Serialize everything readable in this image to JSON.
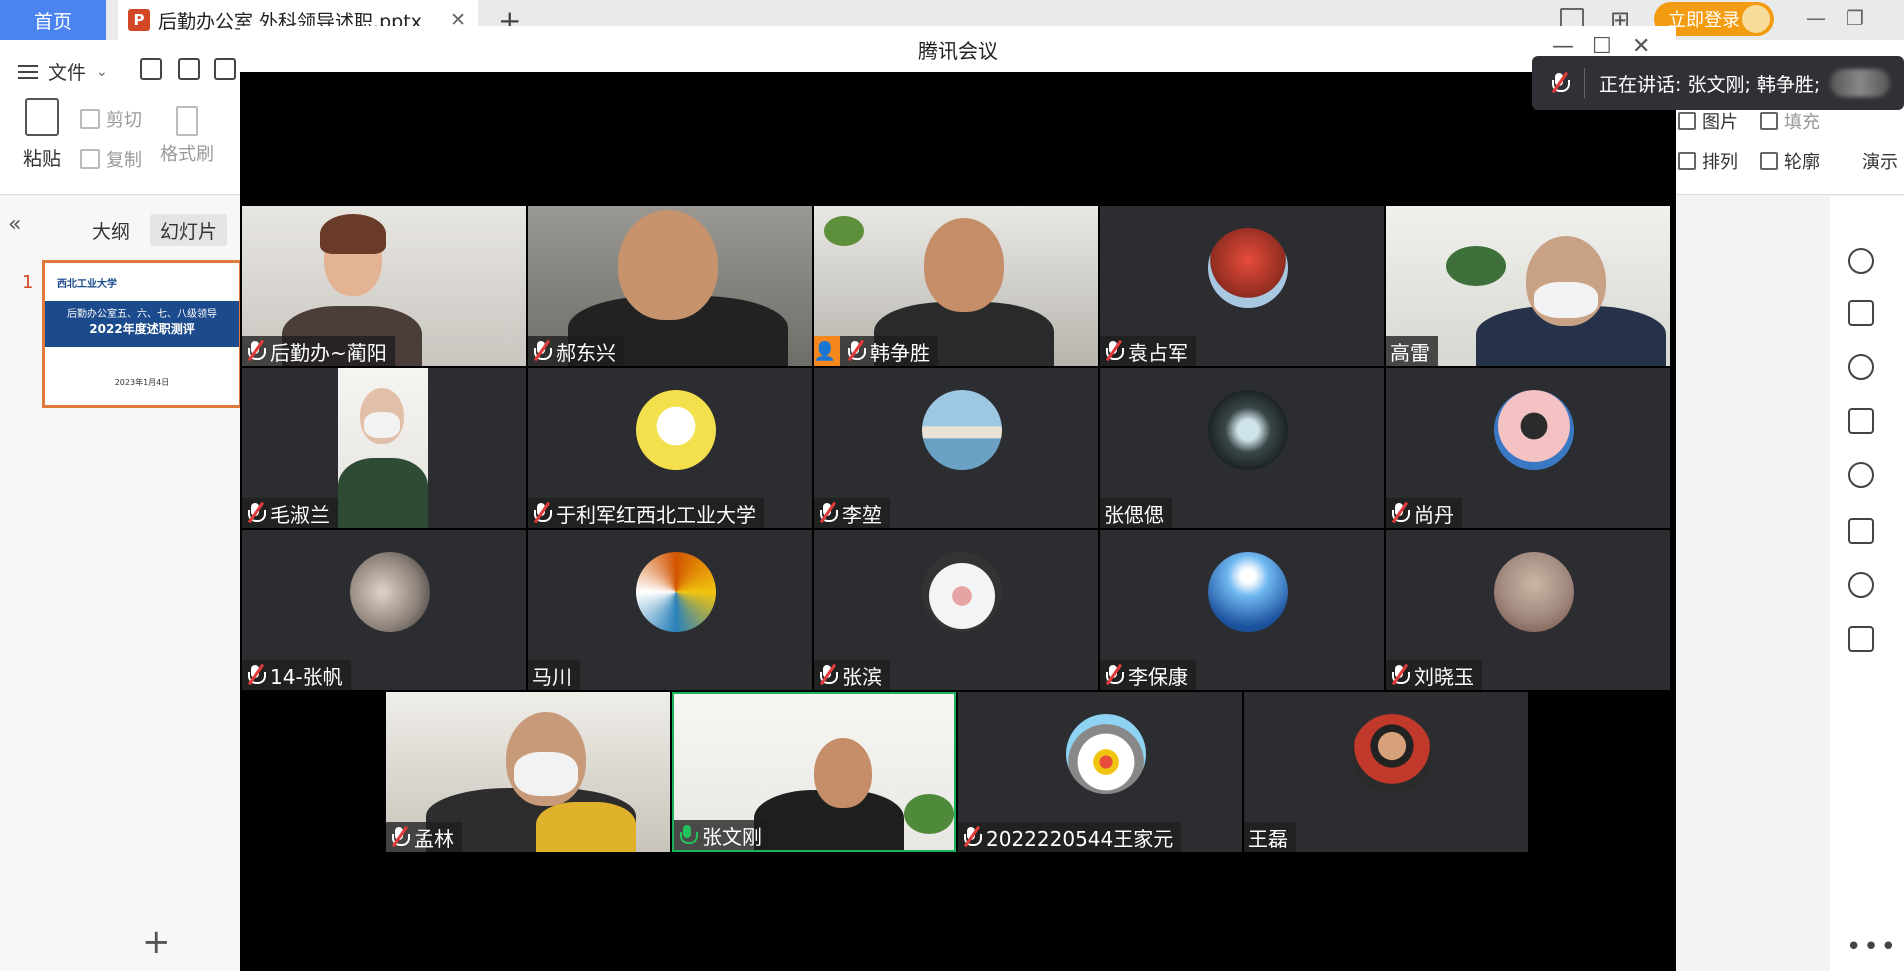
{
  "wps": {
    "home_tab": "首页",
    "doc_tab": "后勤办公室 外科领导述职.pptx",
    "doc_icon": "P",
    "login_label": "立即登录",
    "file_menu": "文件",
    "ribbon": {
      "paste": "粘贴",
      "cut": "剪切",
      "copy": "复制",
      "format_painter": "格式刷",
      "picture": "图片",
      "fill": "填充",
      "arrange": "排列",
      "outline": "轮廓",
      "present": "演示"
    },
    "pane_tabs": [
      "大纲",
      "幻灯片"
    ],
    "slide_number": "1",
    "thumb": {
      "logo": "西北工业大学",
      "line1": "后勤办公室五、六、七、八级领导",
      "line2": "2022年度述职测评",
      "date": "2023年1月4日"
    },
    "add_slide": "+"
  },
  "meeting": {
    "title": "腾讯会议",
    "speaking_label": "正在讲话: 张文刚; 韩争胜;",
    "participants": [
      {
        "name": "后勤办~蔺阳",
        "mic": "muted",
        "kind": "camera",
        "palette": "#c9c6c0"
      },
      {
        "name": "郝东兴",
        "mic": "muted",
        "kind": "camera",
        "palette": "#6e6d68"
      },
      {
        "name": "韩争胜",
        "mic": "muted",
        "kind": "camera",
        "host": true,
        "palette": "#b7b4ad"
      },
      {
        "name": "袁占军",
        "mic": "muted",
        "kind": "avatar",
        "color": "#c0392b"
      },
      {
        "name": "高雷",
        "mic": "none",
        "kind": "camera",
        "palette": "#d8d8d2"
      },
      {
        "name": "毛淑兰",
        "mic": "muted",
        "kind": "camera-portrait",
        "palette": "#e5e3df"
      },
      {
        "name": "于利军红西北工业大学",
        "mic": "muted",
        "kind": "avatar",
        "color": "#f4e04d"
      },
      {
        "name": "李堃",
        "mic": "muted",
        "kind": "avatar",
        "color": "#7fb4cf"
      },
      {
        "name": "张偲偲",
        "mic": "none",
        "kind": "avatar",
        "color": "#5d6d6d"
      },
      {
        "name": "尚丹",
        "mic": "muted",
        "kind": "avatar",
        "color": "#f4c2c2"
      },
      {
        "name": "14-张帆",
        "mic": "muted",
        "kind": "avatar",
        "color": "#8a7f77"
      },
      {
        "name": "马川",
        "mic": "none",
        "kind": "avatar",
        "color": "#d35400"
      },
      {
        "name": "张滨",
        "mic": "muted",
        "kind": "avatar",
        "color": "#dcdcdc"
      },
      {
        "name": "李保康",
        "mic": "muted",
        "kind": "avatar",
        "color": "#2e86de"
      },
      {
        "name": "刘晓玉",
        "mic": "muted",
        "kind": "avatar",
        "color": "#a1887f"
      },
      {
        "name": "孟林",
        "mic": "muted",
        "kind": "camera",
        "palette": "#c8c4bb"
      },
      {
        "name": "张文刚",
        "mic": "on",
        "kind": "camera",
        "speaking": true,
        "palette": "#e9e7e2"
      },
      {
        "name": "2022220544王家元",
        "mic": "muted",
        "kind": "avatar",
        "color": "#e8e8e8"
      },
      {
        "name": "王磊",
        "mic": "none",
        "kind": "avatar",
        "color": "#c0392b"
      }
    ]
  }
}
